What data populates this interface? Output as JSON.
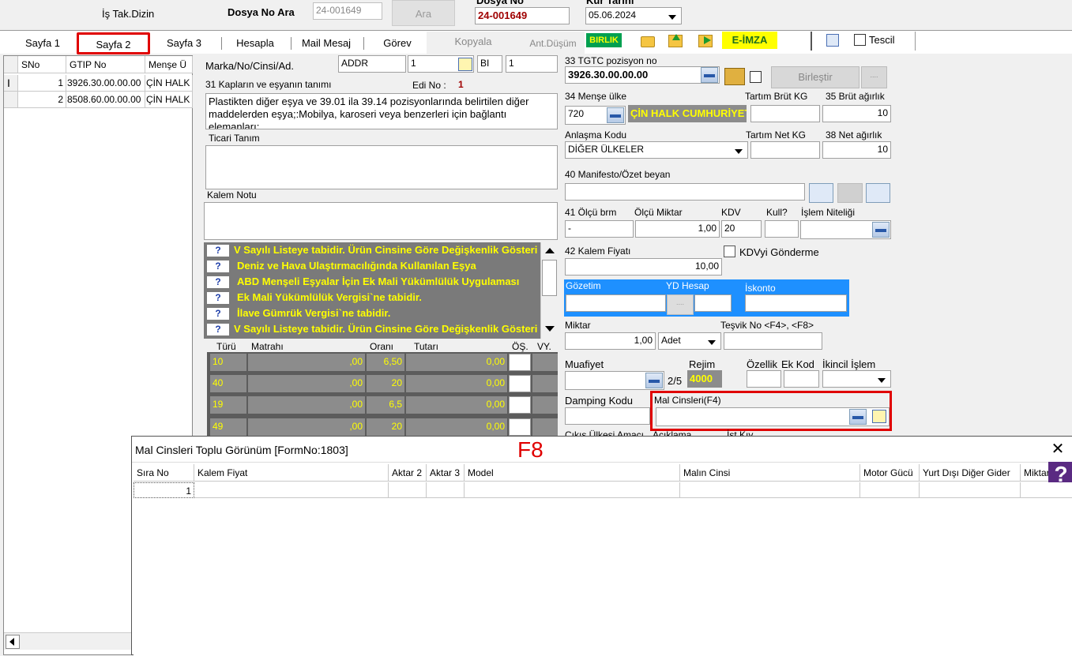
{
  "header": {
    "is_takip": "İş Tak.Dizin",
    "dosya_no_ara_label": "Dosya No Ara",
    "dosya_no_ara_placeholder": "24-001649",
    "ara_button": "Ara",
    "dosya_no_label": "Dosya No",
    "dosya_no_value": "24-001649",
    "kur_tarihi_label": "Kur Tarihi",
    "kur_tarihi_value": "05.06.2024"
  },
  "tabs": [
    "Sayfa 1",
    "Sayfa 2",
    "Sayfa 3",
    "Hesapla",
    "Mail Mesaj",
    "Görev",
    "Kopyala",
    "Ant.Düşüm"
  ],
  "toolbar": {
    "birlik": "BIRLIK",
    "eimza": "E-İMZA",
    "tescil": "Tescil"
  },
  "left_grid": {
    "columns": [
      "SNo",
      "GTIP No",
      "Menşe Ü"
    ],
    "rows": [
      {
        "sno": "1",
        "gtip": "3926.30.00.00.00",
        "mense": "ÇİN HALK"
      },
      {
        "sno": "2",
        "gtip": "8508.60.00.00.00",
        "mense": "ÇİN HALK"
      }
    ]
  },
  "middle": {
    "marka_label": "Marka/No/Cinsi/Ad.",
    "marka_value": "ADDR",
    "marka_no": "1",
    "marka_bi": "BI",
    "marka_ad": "1",
    "kaplar_label": "31 Kapların ve eşyanın tanımı",
    "edi_no_label": "Edi No :",
    "edi_no_value": "1",
    "tanim_text": "Plastikten diğer eşya ve 39.01 ila 39.14 pozisyonlarında belirtilen diğer maddelerden eşya;:Mobilya, karoseri veya benzerleri için bağlantı elemanları;",
    "ticari_tanim_label": "Ticari Tanım",
    "kalem_notu_label": "Kalem Notu",
    "info_items": [
      "V Sayılı Listeye tabidir. Ürün Cinsine Göre Değişkenlik Gösterir",
      "Deniz ve Hava Ulaştırmacılığında Kullanılan Eşya",
      "ABD Menşeli Eşyalar İçin Ek Mali Yükümlülük Uygulaması",
      "Ek Mali Yükümlülük Vergisi`ne tabidir.",
      "İlave Gümrük Vergisi`ne tabidir.",
      "V Sayılı Listeye tabidir. Ürün Cinsine Göre Değişkenlik Gösterir"
    ],
    "tax_headers": [
      "Türü",
      "Matrahı",
      "Oranı",
      "Tutarı",
      "ÖŞ.",
      "VY."
    ],
    "tax_rows": [
      {
        "turu": "10",
        "matrah": ",00",
        "oran": "6,50",
        "tutar": "0,00"
      },
      {
        "turu": "40",
        "matrah": ",00",
        "oran": "20",
        "tutar": "0,00"
      },
      {
        "turu": "19",
        "matrah": ",00",
        "oran": "6,5",
        "tutar": "0,00"
      },
      {
        "turu": "49",
        "matrah": ",00",
        "oran": "20",
        "tutar": "0,00"
      }
    ]
  },
  "right": {
    "tgtc_label": "33 TGTC pozisyon no",
    "tgtc_value": "3926.30.00.00.00",
    "birlestir": "Birleştir",
    "birlestir_extra": "....",
    "mense_label": "34 Menşe ülke",
    "mense_code": "720",
    "mense_name": "ÇİN HALK CUMHURİYETİ",
    "tartim_brut_label": "Tartım Brüt KG",
    "brut_label": "35 Brüt ağırlık",
    "brut_value": "10",
    "anlasma_label": "Anlaşma Kodu",
    "anlasma_value": "DİĞER ÜLKELER",
    "tartim_net_label": "Tartım Net KG",
    "net_label": "38 Net ağırlık",
    "net_value": "10",
    "manifesto_label": "40 Manifesto/Özet beyan",
    "olcu_label": "41 Ölçü brm",
    "olcu_value": "-",
    "olcu_miktar_label": "Ölçü Miktar",
    "olcu_miktar_value": "1,00",
    "kdv_label": "KDV",
    "kdv_value": "20",
    "kull_label": "Kull?",
    "islem_niteligi_label": "İşlem Niteliği",
    "kalem_fiyati_label": "42 Kalem Fiyatı",
    "kalem_fiyati_value": "10,00",
    "kdvyi_label": "KDVyi Gönderme",
    "gozetim_label": "Gözetim",
    "yd_hesap_label": "YD Hesap",
    "iskonto_label": "İskonto",
    "miktar_label": "Miktar",
    "miktar_value": "1,00",
    "miktar_unit": "Adet",
    "tesvik_label": "Teşvik No <F4>, <F8>",
    "muafiyet_label": "Muafiyet",
    "muafiyet_page": "2/5",
    "rejim_label": "Rejim",
    "rejim_value": "4000",
    "ozellik_label": "Özellik",
    "ek_kod_label": "Ek Kod",
    "ikincil_label": "İkincil İşlem",
    "damping_label": "Damping Kodu",
    "mal_cinsleri_label": "Mal Cinsleri(F4)",
    "cut_label_1": "Çıkış Ülkesi Amacı",
    "cut_label_2": "Açıklama",
    "cut_label_3": "İst.Kıy."
  },
  "dialog": {
    "title": "Mal Cinsleri Toplu Görünüm [FormNo:1803]",
    "annotation": "F8",
    "help": "?",
    "columns": [
      "Sıra No",
      "Kalem Fiyat",
      "Aktar 2",
      "Aktar 3",
      "Model",
      "Malın Cinsi",
      "Motor Gücü",
      "Yurt Dışı Diğer Gider",
      "Miktar"
    ],
    "rows": [
      {
        "sira_no": "1"
      }
    ]
  },
  "colors": {
    "highlight_red": "#e00000",
    "birlik_green": "#00a050",
    "eimza_yellow": "#ffff00",
    "info_bg": "#7a7a7a",
    "info_text": "#ffff00",
    "blue_panel": "#1e90ff"
  }
}
